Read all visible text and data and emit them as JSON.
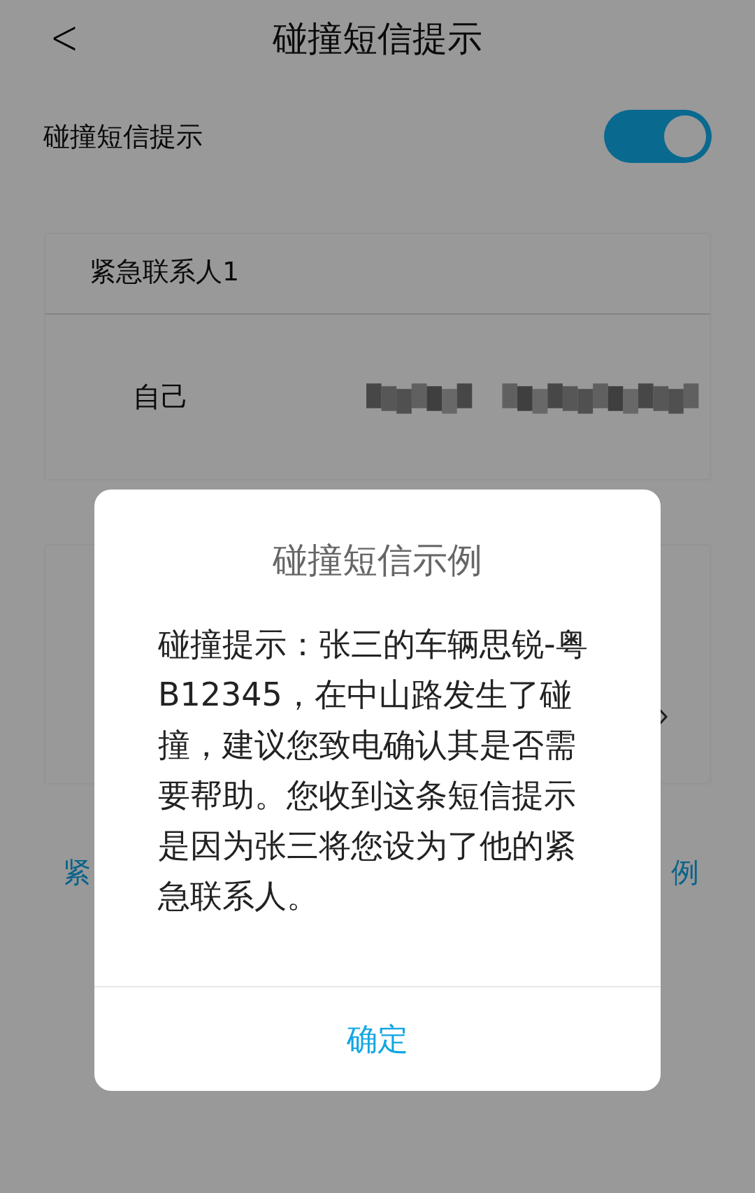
{
  "header": {
    "back": "<",
    "title": "碰撞短信提示"
  },
  "setting": {
    "label": "碰撞短信提示",
    "on": true
  },
  "contact_card": {
    "title": "紧急联系人1",
    "name": "自己"
  },
  "footer_links": [
    "紧",
    "例"
  ],
  "dialog": {
    "title": "碰撞短信示例",
    "message": "碰撞提示：张三的车辆思锐-粤B12345，在中山路发生了碰撞，建议您致电确认其是否需要帮助。您收到这条短信提示是因为张三将您设为了他的紧急联系人。",
    "button": "确定"
  }
}
